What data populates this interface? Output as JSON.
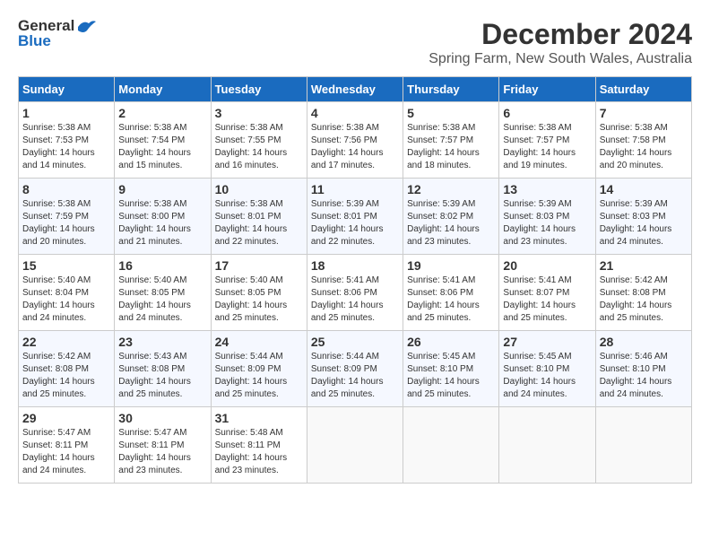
{
  "header": {
    "logo_general": "General",
    "logo_blue": "Blue",
    "title": "December 2024",
    "subtitle": "Spring Farm, New South Wales, Australia"
  },
  "calendar": {
    "days_of_week": [
      "Sunday",
      "Monday",
      "Tuesday",
      "Wednesday",
      "Thursday",
      "Friday",
      "Saturday"
    ],
    "weeks": [
      [
        {
          "day": "",
          "info": ""
        },
        {
          "day": "2",
          "info": "Sunrise: 5:38 AM\nSunset: 7:54 PM\nDaylight: 14 hours\nand 15 minutes."
        },
        {
          "day": "3",
          "info": "Sunrise: 5:38 AM\nSunset: 7:55 PM\nDaylight: 14 hours\nand 16 minutes."
        },
        {
          "day": "4",
          "info": "Sunrise: 5:38 AM\nSunset: 7:56 PM\nDaylight: 14 hours\nand 17 minutes."
        },
        {
          "day": "5",
          "info": "Sunrise: 5:38 AM\nSunset: 7:57 PM\nDaylight: 14 hours\nand 18 minutes."
        },
        {
          "day": "6",
          "info": "Sunrise: 5:38 AM\nSunset: 7:57 PM\nDaylight: 14 hours\nand 19 minutes."
        },
        {
          "day": "7",
          "info": "Sunrise: 5:38 AM\nSunset: 7:58 PM\nDaylight: 14 hours\nand 20 minutes."
        }
      ],
      [
        {
          "day": "1",
          "info": "Sunrise: 5:38 AM\nSunset: 7:53 PM\nDaylight: 14 hours\nand 14 minutes."
        },
        null,
        null,
        null,
        null,
        null,
        null
      ],
      [
        {
          "day": "8",
          "info": "Sunrise: 5:38 AM\nSunset: 7:59 PM\nDaylight: 14 hours\nand 20 minutes."
        },
        {
          "day": "9",
          "info": "Sunrise: 5:38 AM\nSunset: 8:00 PM\nDaylight: 14 hours\nand 21 minutes."
        },
        {
          "day": "10",
          "info": "Sunrise: 5:38 AM\nSunset: 8:01 PM\nDaylight: 14 hours\nand 22 minutes."
        },
        {
          "day": "11",
          "info": "Sunrise: 5:39 AM\nSunset: 8:01 PM\nDaylight: 14 hours\nand 22 minutes."
        },
        {
          "day": "12",
          "info": "Sunrise: 5:39 AM\nSunset: 8:02 PM\nDaylight: 14 hours\nand 23 minutes."
        },
        {
          "day": "13",
          "info": "Sunrise: 5:39 AM\nSunset: 8:03 PM\nDaylight: 14 hours\nand 23 minutes."
        },
        {
          "day": "14",
          "info": "Sunrise: 5:39 AM\nSunset: 8:03 PM\nDaylight: 14 hours\nand 24 minutes."
        }
      ],
      [
        {
          "day": "15",
          "info": "Sunrise: 5:40 AM\nSunset: 8:04 PM\nDaylight: 14 hours\nand 24 minutes."
        },
        {
          "day": "16",
          "info": "Sunrise: 5:40 AM\nSunset: 8:05 PM\nDaylight: 14 hours\nand 24 minutes."
        },
        {
          "day": "17",
          "info": "Sunrise: 5:40 AM\nSunset: 8:05 PM\nDaylight: 14 hours\nand 25 minutes."
        },
        {
          "day": "18",
          "info": "Sunrise: 5:41 AM\nSunset: 8:06 PM\nDaylight: 14 hours\nand 25 minutes."
        },
        {
          "day": "19",
          "info": "Sunrise: 5:41 AM\nSunset: 8:06 PM\nDaylight: 14 hours\nand 25 minutes."
        },
        {
          "day": "20",
          "info": "Sunrise: 5:41 AM\nSunset: 8:07 PM\nDaylight: 14 hours\nand 25 minutes."
        },
        {
          "day": "21",
          "info": "Sunrise: 5:42 AM\nSunset: 8:08 PM\nDaylight: 14 hours\nand 25 minutes."
        }
      ],
      [
        {
          "day": "22",
          "info": "Sunrise: 5:42 AM\nSunset: 8:08 PM\nDaylight: 14 hours\nand 25 minutes."
        },
        {
          "day": "23",
          "info": "Sunrise: 5:43 AM\nSunset: 8:08 PM\nDaylight: 14 hours\nand 25 minutes."
        },
        {
          "day": "24",
          "info": "Sunrise: 5:44 AM\nSunset: 8:09 PM\nDaylight: 14 hours\nand 25 minutes."
        },
        {
          "day": "25",
          "info": "Sunrise: 5:44 AM\nSunset: 8:09 PM\nDaylight: 14 hours\nand 25 minutes."
        },
        {
          "day": "26",
          "info": "Sunrise: 5:45 AM\nSunset: 8:10 PM\nDaylight: 14 hours\nand 25 minutes."
        },
        {
          "day": "27",
          "info": "Sunrise: 5:45 AM\nSunset: 8:10 PM\nDaylight: 14 hours\nand 24 minutes."
        },
        {
          "day": "28",
          "info": "Sunrise: 5:46 AM\nSunset: 8:10 PM\nDaylight: 14 hours\nand 24 minutes."
        }
      ],
      [
        {
          "day": "29",
          "info": "Sunrise: 5:47 AM\nSunset: 8:11 PM\nDaylight: 14 hours\nand 24 minutes."
        },
        {
          "day": "30",
          "info": "Sunrise: 5:47 AM\nSunset: 8:11 PM\nDaylight: 14 hours\nand 23 minutes."
        },
        {
          "day": "31",
          "info": "Sunrise: 5:48 AM\nSunset: 8:11 PM\nDaylight: 14 hours\nand 23 minutes."
        },
        {
          "day": "",
          "info": ""
        },
        {
          "day": "",
          "info": ""
        },
        {
          "day": "",
          "info": ""
        },
        {
          "day": "",
          "info": ""
        }
      ]
    ]
  }
}
